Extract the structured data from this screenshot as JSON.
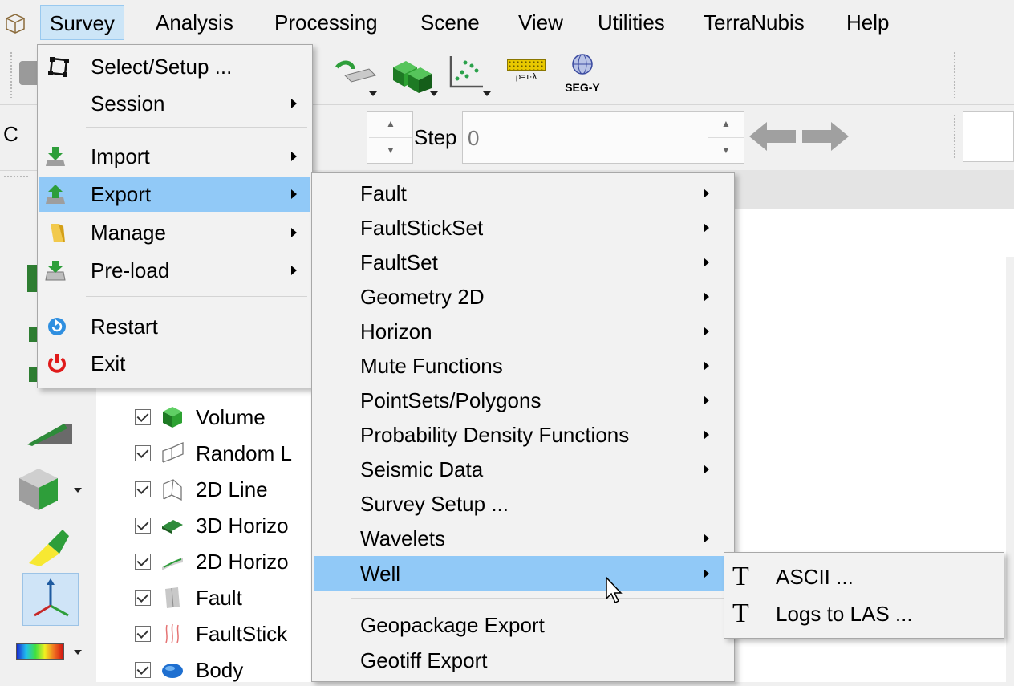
{
  "menubar": {
    "items": [
      "Survey",
      "Analysis",
      "Processing",
      "Scene",
      "View",
      "Utilities",
      "TerraNubis",
      "Help"
    ]
  },
  "toolbar": {
    "segy_label": "SEG-Y",
    "rho_label": "ρ=τ·λ",
    "step_label": "Step",
    "step_value": "0",
    "partial_label": "C"
  },
  "survey_menu": {
    "items": [
      {
        "label": "Select/Setup ...",
        "icon": "select-setup-icon",
        "submenu": false
      },
      {
        "label": "Session",
        "icon": "",
        "submenu": true
      },
      {
        "label": "Import",
        "icon": "import-icon",
        "submenu": true
      },
      {
        "label": "Export",
        "icon": "export-icon",
        "submenu": true,
        "highlighted": true
      },
      {
        "label": "Manage",
        "icon": "folder-icon",
        "submenu": true
      },
      {
        "label": "Pre-load",
        "icon": "preload-icon",
        "submenu": true
      },
      {
        "label": "Restart",
        "icon": "restart-icon",
        "submenu": false
      },
      {
        "label": "Exit",
        "icon": "power-icon",
        "submenu": false
      }
    ]
  },
  "export_menu": {
    "items": [
      {
        "label": "Fault",
        "submenu": true
      },
      {
        "label": "FaultStickSet",
        "submenu": true
      },
      {
        "label": "FaultSet",
        "submenu": true
      },
      {
        "label": "Geometry 2D",
        "submenu": true
      },
      {
        "label": "Horizon",
        "submenu": true
      },
      {
        "label": "Mute Functions",
        "submenu": true
      },
      {
        "label": "PointSets/Polygons",
        "submenu": true
      },
      {
        "label": "Probability Density Functions",
        "submenu": true
      },
      {
        "label": "Seismic Data",
        "submenu": true
      },
      {
        "label": "Survey Setup ...",
        "submenu": false
      },
      {
        "label": "Wavelets",
        "submenu": true
      },
      {
        "label": "Well",
        "submenu": true,
        "highlighted": true
      },
      {
        "label": "Geopackage Export",
        "submenu": false
      },
      {
        "label": "Geotiff Export",
        "submenu": false
      }
    ]
  },
  "well_menu": {
    "items": [
      {
        "label": "ASCII ...",
        "icon": "text-T-icon"
      },
      {
        "label": "Logs to LAS ...",
        "icon": "text-T-icon"
      }
    ]
  },
  "tree": {
    "items": [
      {
        "label": "Volume",
        "checked": true,
        "icon": "volume-cube-icon"
      },
      {
        "label": "Random L",
        "checked": true,
        "icon": "random-line-icon"
      },
      {
        "label": "2D Line",
        "checked": true,
        "icon": "2d-line-icon"
      },
      {
        "label": "3D Horizo",
        "checked": true,
        "icon": "3d-horizon-icon"
      },
      {
        "label": "2D Horizo",
        "checked": true,
        "icon": "2d-horizon-icon"
      },
      {
        "label": "Fault",
        "checked": true,
        "icon": "fault-icon"
      },
      {
        "label": "FaultStick",
        "checked": true,
        "icon": "faultstick-icon"
      },
      {
        "label": "Body",
        "checked": true,
        "icon": "body-icon"
      }
    ]
  },
  "colors": {
    "highlight": "#91c9f7",
    "menubar_active": "#cce5f7",
    "background": "#f0f0f0"
  }
}
